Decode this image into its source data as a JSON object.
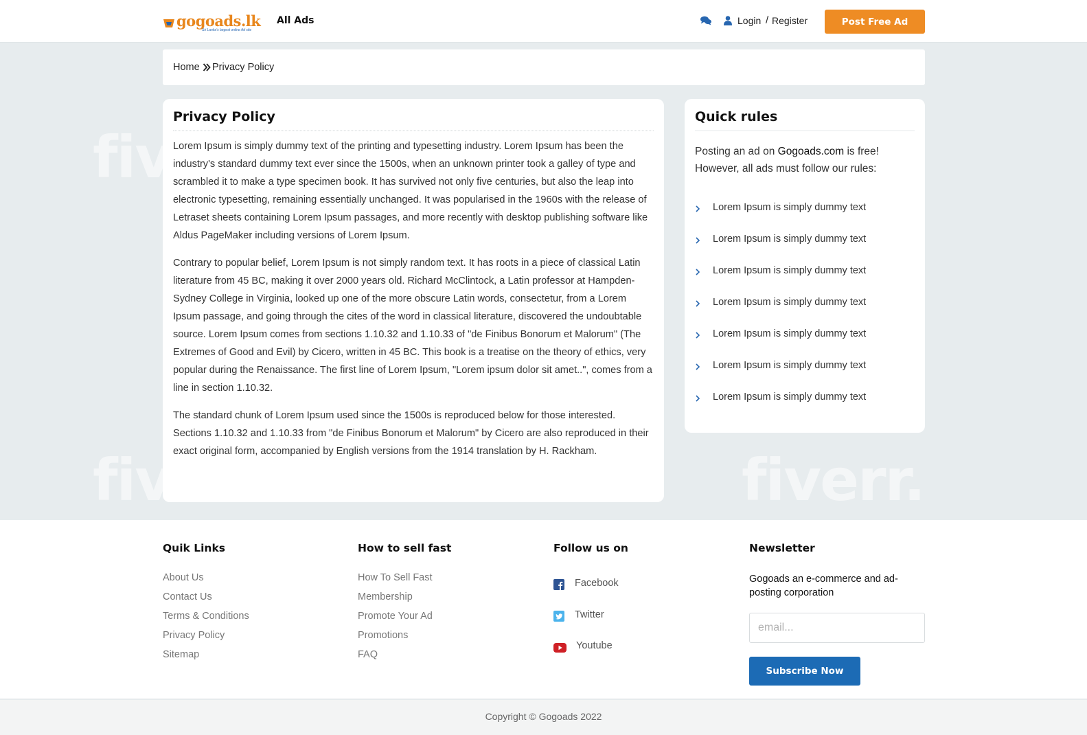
{
  "header": {
    "logo_text": "gogoads.lk",
    "logo_tagline": "Sri Lanka's largest online Ad site",
    "nav_all_ads": "All Ads",
    "login": "Login",
    "separator": "/",
    "register": "Register",
    "post_ad": "Post Free Ad",
    "chat_icon": "comments-icon",
    "user_icon": "user-icon",
    "accent_color": "#ee8c24"
  },
  "breadcrumb": {
    "home": "Home",
    "current": "Privacy Policy"
  },
  "main": {
    "title": "Privacy Policy",
    "paragraphs": [
      "Lorem Ipsum is simply dummy text of the printing and typesetting industry. Lorem Ipsum has been the industry's standard dummy text ever since the 1500s, when an unknown printer took a galley of type and scrambled it to make a type specimen book. It has survived not only five centuries, but also the leap into electronic typesetting, remaining essentially unchanged. It was popularised in the 1960s with the release of Letraset sheets containing Lorem Ipsum passages, and more recently with desktop publishing software like Aldus PageMaker including versions of Lorem Ipsum.",
      "Contrary to popular belief, Lorem Ipsum is not simply random text. It has roots in a piece of classical Latin literature from 45 BC, making it over 2000 years old. Richard McClintock, a Latin professor at Hampden-Sydney College in Virginia, looked up one of the more obscure Latin words, consectetur, from a Lorem Ipsum passage, and going through the cites of the word in classical literature, discovered the undoubtable source. Lorem Ipsum comes from sections 1.10.32 and 1.10.33 of \"de Finibus Bonorum et Malorum\" (The Extremes of Good and Evil) by Cicero, written in 45 BC. This book is a treatise on the theory of ethics, very popular during the Renaissance. The first line of Lorem Ipsum, \"Lorem ipsum dolor sit amet..\", comes from a line in section 1.10.32.",
      "The standard chunk of Lorem Ipsum used since the 1500s is reproduced below for those interested. Sections 1.10.32 and 1.10.33 from \"de Finibus Bonorum et Malorum\" by Cicero are also reproduced in their exact original form, accompanied by English versions from the 1914 translation by H. Rackham."
    ]
  },
  "rules": {
    "title": "Quick rules",
    "intro_prefix": "Posting an ad on ",
    "intro_site": "Gogoads.com",
    "intro_suffix": " is free! However, all ads must follow our rules:",
    "items": [
      "Lorem Ipsum is simply dummy text",
      "Lorem Ipsum is simply dummy text",
      "Lorem Ipsum is simply dummy text",
      "Lorem Ipsum is simply dummy text",
      "Lorem Ipsum is simply dummy text",
      "Lorem Ipsum is simply dummy text",
      "Lorem Ipsum is simply dummy text"
    ]
  },
  "footer": {
    "quick_links": {
      "title": "Quik Links",
      "items": [
        "About Us",
        "Contact Us",
        "Terms & Conditions",
        "Privacy Policy",
        "Sitemap"
      ]
    },
    "sell_fast": {
      "title": "How to sell fast",
      "items": [
        "How To Sell Fast",
        "Membership",
        "Promote Your Ad",
        "Promotions",
        "FAQ"
      ]
    },
    "follow": {
      "title": "Follow us on",
      "items": [
        {
          "label": "Facebook",
          "icon": "facebook-icon"
        },
        {
          "label": "Twitter",
          "icon": "twitter-icon"
        },
        {
          "label": "Youtube",
          "icon": "youtube-icon"
        }
      ]
    },
    "newsletter": {
      "title": "Newsletter",
      "description": "Gogoads an e-commerce and ad-posting corporation",
      "placeholder": "email...",
      "button": "Subscribe Now"
    },
    "copyright": "Copyright © Gogoads 2022"
  },
  "watermark": "fiverr."
}
